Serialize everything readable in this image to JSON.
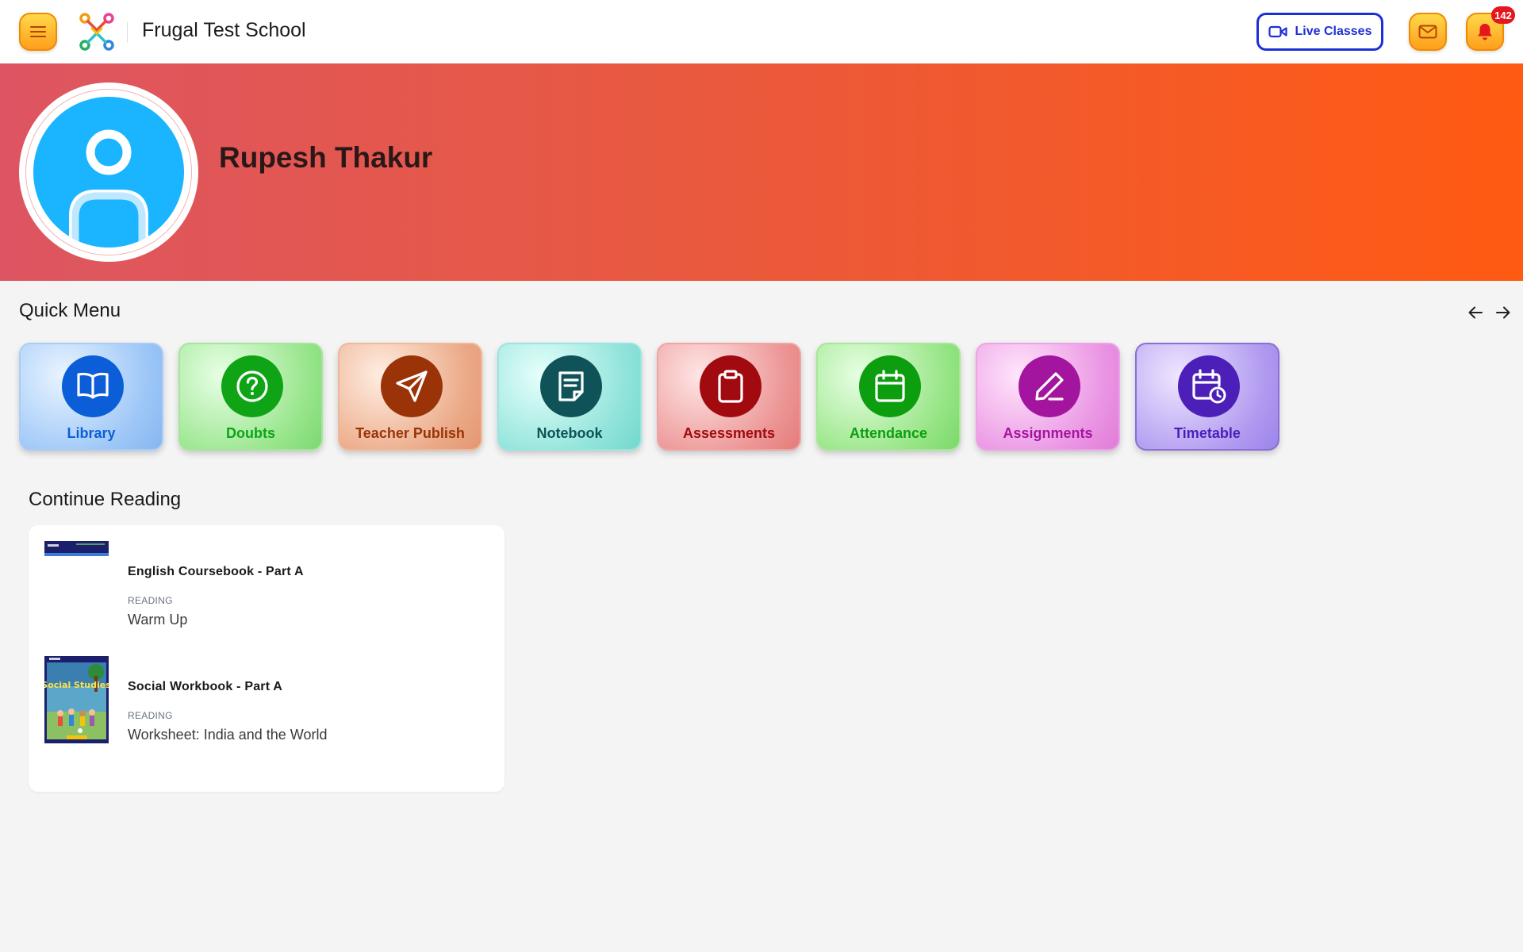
{
  "header": {
    "school_name": "Frugal Test School",
    "live_classes_label": "Live Classes",
    "notification_count": "142",
    "colors": {
      "accent_yellow": "#ffc72c",
      "live_blue": "#1d2fd6",
      "badge_red": "#e3171c"
    }
  },
  "profile": {
    "name": "Rupesh Thakur",
    "avatar_icon": "user-avatar-icon",
    "banner_gradient": [
      "#dd5562",
      "#ff5a12"
    ]
  },
  "quick_menu": {
    "title": "Quick Menu",
    "items": [
      {
        "label": "Library",
        "icon": "book-open-icon",
        "color": "#0b5ed7"
      },
      {
        "label": "Doubts",
        "icon": "question-circle-icon",
        "color": "#0ea416"
      },
      {
        "label": "Teacher Publish",
        "icon": "send-icon",
        "color": "#9a3408"
      },
      {
        "label": "Notebook",
        "icon": "notebook-icon",
        "color": "#0f5257"
      },
      {
        "label": "Assessments",
        "icon": "clipboard-icon",
        "color": "#a10a0f"
      },
      {
        "label": "Attendance",
        "icon": "calendar-icon",
        "color": "#0d9e0f"
      },
      {
        "label": "Assignments",
        "icon": "pencil-icon",
        "color": "#a3159e"
      },
      {
        "label": "Timetable",
        "icon": "calendar-clock-icon",
        "color": "#4b1fb8"
      }
    ]
  },
  "continue_reading": {
    "title": "Continue Reading",
    "books": [
      {
        "title": "English Coursebook - Part A",
        "status": "READING",
        "chapter": "Warm Up"
      },
      {
        "title": "Social Workbook - Part A",
        "status": "READING",
        "chapter": "Worksheet: India and the World",
        "cover_text": "Social Studies"
      }
    ]
  }
}
